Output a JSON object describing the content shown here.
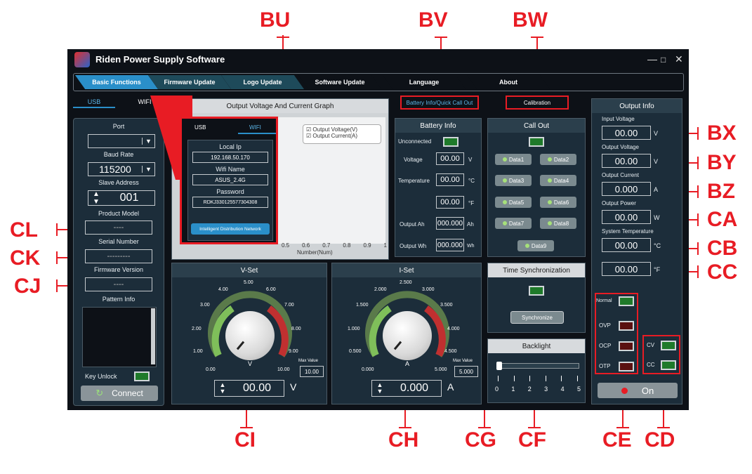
{
  "callouts": {
    "bu": "BU",
    "bv": "BV",
    "bw": "BW",
    "bx": "BX",
    "by": "BY",
    "bz": "BZ",
    "ca": "CA",
    "cb": "CB",
    "cc": "CC",
    "cd": "CD",
    "ce": "CE",
    "cf": "CF",
    "cg": "CG",
    "ch": "CH",
    "ci": "CI",
    "cj": "CJ",
    "ck": "CK",
    "cl": "CL"
  },
  "window": {
    "title": "Riden Power Supply Software",
    "minimize": "—",
    "maximize": "□",
    "close": "✕"
  },
  "tabs": [
    "Basic Functions",
    "Firmware Update",
    "Logo Update",
    "Software Update",
    "Language",
    "About"
  ],
  "connection": {
    "tab_usb": "USB",
    "tab_wifi": "WIFI",
    "port_label": "Port",
    "port_value": "",
    "baud_label": "Baud Rate",
    "baud_value": "115200",
    "slave_label": "Slave Address",
    "slave_value": "001",
    "model_label": "Product Model",
    "model_value": "----",
    "serial_label": "Serial Number",
    "serial_value": "---------",
    "firmware_label": "Firmware Version",
    "firmware_value": "----",
    "pattern_label": "Pattern Info",
    "key_unlock": "Key Unlock",
    "connect": "Connect"
  },
  "wifi_popup": {
    "tab_usb": "USB",
    "tab_wifi": "WIFI",
    "local_ip_label": "Local Ip",
    "local_ip": "192.168.50.170",
    "wifi_name_label": "Wifi Name",
    "wifi_name": "ASUS_2.4G",
    "password_label": "Password",
    "password": "RDKJ330125577304308",
    "network_button": "Intelligent Distribution Network"
  },
  "graph": {
    "title": "Output Voltage And Current Graph",
    "legend": [
      "Output Voltage(V)",
      "Output Current(A)"
    ],
    "x_ticks": [
      "0.5",
      "0.6",
      "0.7",
      "0.8",
      "0.9",
      "1"
    ],
    "xlabel": "Number(Num)"
  },
  "battery": {
    "tab": "Battery Info/Quick Call Out",
    "title": "Battery Info",
    "status": "Unconnected",
    "voltage_label": "Voltage",
    "voltage_value": "00.00",
    "voltage_unit": "V",
    "temp_label": "Temperature",
    "temp_c": "00.00",
    "temp_c_unit": "°C",
    "temp_f": "00.00",
    "temp_f_unit": "°F",
    "ah_label": "Output Ah",
    "ah_value": "000.000",
    "ah_unit": "Ah",
    "wh_label": "Output Wh",
    "wh_value": "000.000",
    "wh_unit": "Wh"
  },
  "callout_panel": {
    "tab": "Calibration",
    "title": "Call Out",
    "buttons": [
      "Data1",
      "Data2",
      "Data3",
      "Data4",
      "Data5",
      "Data6",
      "Data7",
      "Data8",
      "Data9"
    ]
  },
  "time_sync": {
    "title": "Time Synchronization",
    "button": "Synchronize"
  },
  "backlight": {
    "title": "Backlight",
    "ticks": [
      "0",
      "1",
      "2",
      "3",
      "4",
      "5"
    ],
    "level": 0
  },
  "output_info": {
    "title": "Output Info",
    "input_voltage_label": "Input Voltage",
    "input_voltage": "00.00",
    "input_voltage_unit": "V",
    "output_voltage_label": "Output Voltage",
    "output_voltage": "00.00",
    "output_voltage_unit": "V",
    "output_current_label": "Output Current",
    "output_current": "0.000",
    "output_current_unit": "A",
    "output_power_label": "Output Power",
    "output_power": "00.00",
    "output_power_unit": "W",
    "sys_temp_label": "System Temperature",
    "sys_temp_c": "00.00",
    "sys_temp_c_unit": "°C",
    "sys_temp_f": "00.00",
    "sys_temp_f_unit": "°F",
    "status": [
      "Normal",
      "OVP",
      "OCP",
      "OTP"
    ],
    "mode": [
      "CV",
      "CC"
    ],
    "on_button": "On"
  },
  "vset": {
    "title": "V-Set",
    "scale": [
      "0.00",
      "1.00",
      "2.00",
      "3.00",
      "4.00",
      "5.00",
      "6.00",
      "7.00",
      "8.00",
      "9.00",
      "10.00"
    ],
    "knob_label": "V",
    "max_label": "Max Value",
    "max_value": "10.00",
    "value": "00.00",
    "unit": "V"
  },
  "iset": {
    "title": "I-Set",
    "scale": [
      "0.000",
      "0.500",
      "1.000",
      "1.500",
      "2.000",
      "2.500",
      "3.000",
      "3.500",
      "4.000",
      "4.500",
      "5.000"
    ],
    "knob_label": "A",
    "max_label": "Max Value",
    "max_value": "5.000",
    "value": "0.000",
    "unit": "A"
  },
  "colors": {
    "accent": "#e81c24",
    "panel": "#1c2d3a",
    "tab_active": "#2a8fc9",
    "led_green": "#1f7a2a"
  }
}
